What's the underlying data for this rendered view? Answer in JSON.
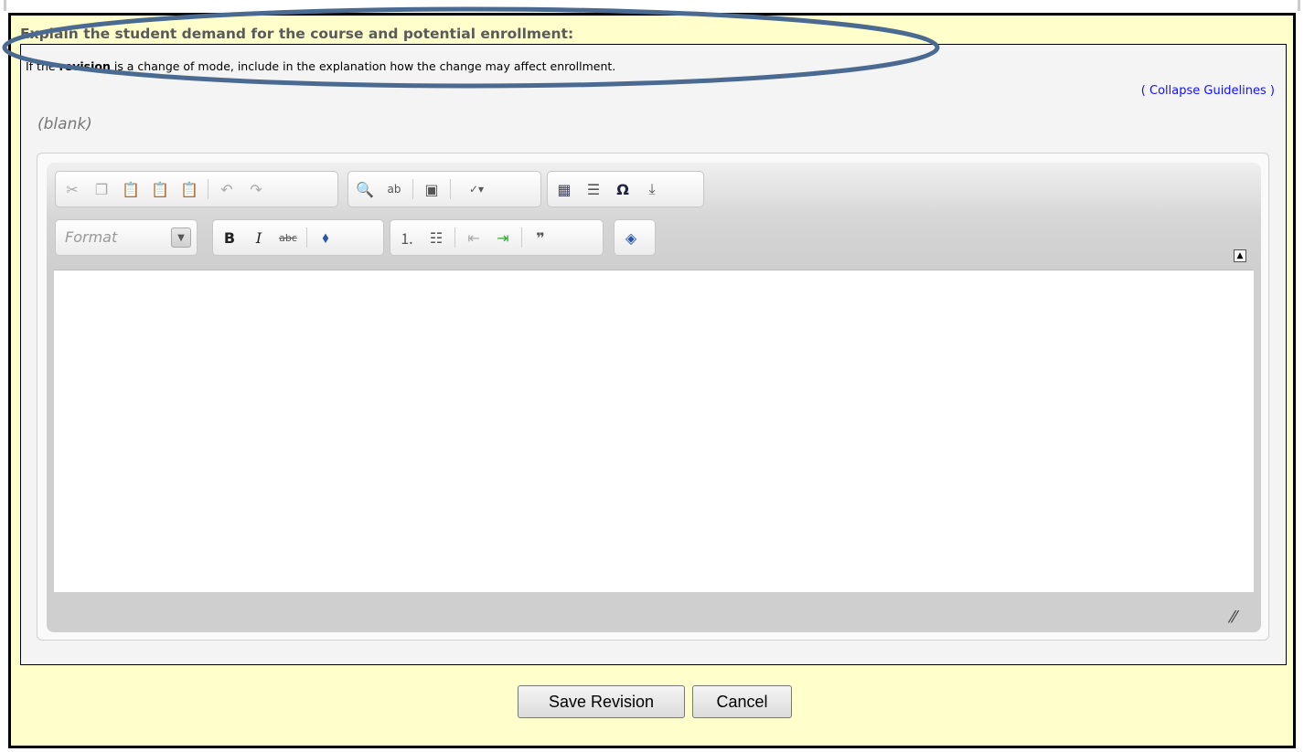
{
  "question": {
    "title": "Explain the student demand for the course and potential enrollment:",
    "guideline_prefix": "If the",
    "guideline_bold": "revision",
    "guideline_suffix": "is a change of mode, include in the explanation how the change may affect enrollment."
  },
  "collapse_link": "( Collapse Guidelines )",
  "current_value": "(blank)",
  "editor": {
    "format_label": "Format",
    "content": ""
  },
  "buttons": {
    "save": "Save Revision",
    "cancel": "Cancel"
  },
  "colors": {
    "panel_bg": "#ffffcc",
    "link": "#1010ff",
    "annotation_ring": "#4b6a91"
  }
}
